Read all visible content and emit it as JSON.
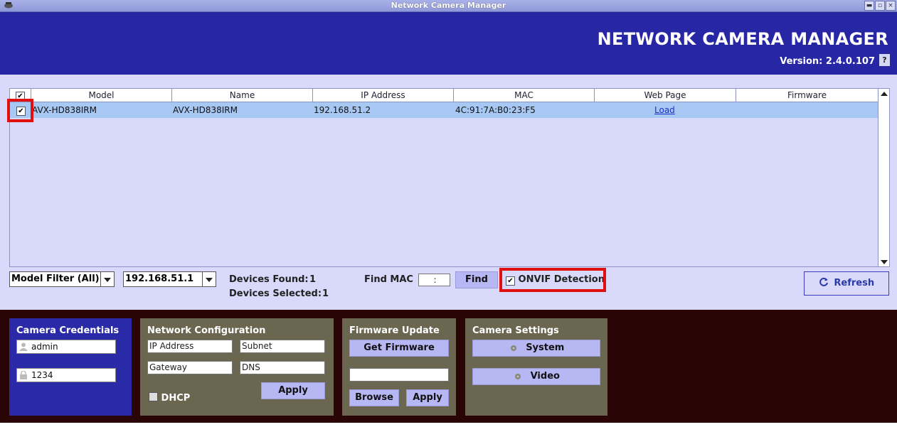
{
  "window": {
    "title": "Network Camera Manager",
    "minimize": "▬",
    "maximize": "▫",
    "close": "×"
  },
  "header": {
    "app_title": "NETWORK CAMERA MANAGER",
    "version": "Version: 2.4.0.107",
    "help": "?"
  },
  "table": {
    "columns": [
      "Model",
      "Name",
      "IP Address",
      "MAC",
      "Web Page",
      "Firmware"
    ],
    "header_checked": true,
    "rows": [
      {
        "checked": true,
        "model": "AVX-HD838IRM",
        "name": "AVX-HD838IRM",
        "ip": "192.168.51.2",
        "mac": "4C:91:7A:B0:23:F5",
        "web_page": "Load",
        "firmware": ""
      }
    ]
  },
  "toolbar": {
    "model_filter": "Model Filter (All)",
    "network": "192.168.51.1",
    "devices_found_label": "Devices Found:",
    "devices_found": "1",
    "devices_selected_label": "Devices Selected:",
    "devices_selected": "1",
    "find_mac_label": "Find MAC",
    "find_mac_value": ":",
    "find_button": "Find",
    "onvif_label": "ONVIF Detection",
    "onvif_checked": true,
    "refresh_button": "Refresh"
  },
  "credentials": {
    "title": "Camera Credentials",
    "username": "admin",
    "password": "1234"
  },
  "network_config": {
    "title": "Network Configuration",
    "ip_placeholder": "IP Address",
    "subnet_placeholder": "Subnet",
    "gateway_placeholder": "Gateway",
    "dns_placeholder": "DNS",
    "dhcp_label": "DHCP",
    "apply_button": "Apply"
  },
  "firmware_update": {
    "title": "Firmware Update",
    "get_firmware_button": "Get Firmware",
    "file_value": "",
    "browse_button": "Browse",
    "apply_button": "Apply"
  },
  "camera_settings": {
    "title": "Camera Settings",
    "system_button": "System",
    "video_button": "Video"
  },
  "colors": {
    "header_bg": "#2727a6",
    "panel_bg": "#d9d9fb",
    "selected_row": "#a8c8f4",
    "bottom_bg": "#2a0505",
    "card_blue": "#2a2aa8",
    "card_olive": "#6a6650",
    "button_bg": "#b7b7f3",
    "highlight_red": "#e01010"
  }
}
